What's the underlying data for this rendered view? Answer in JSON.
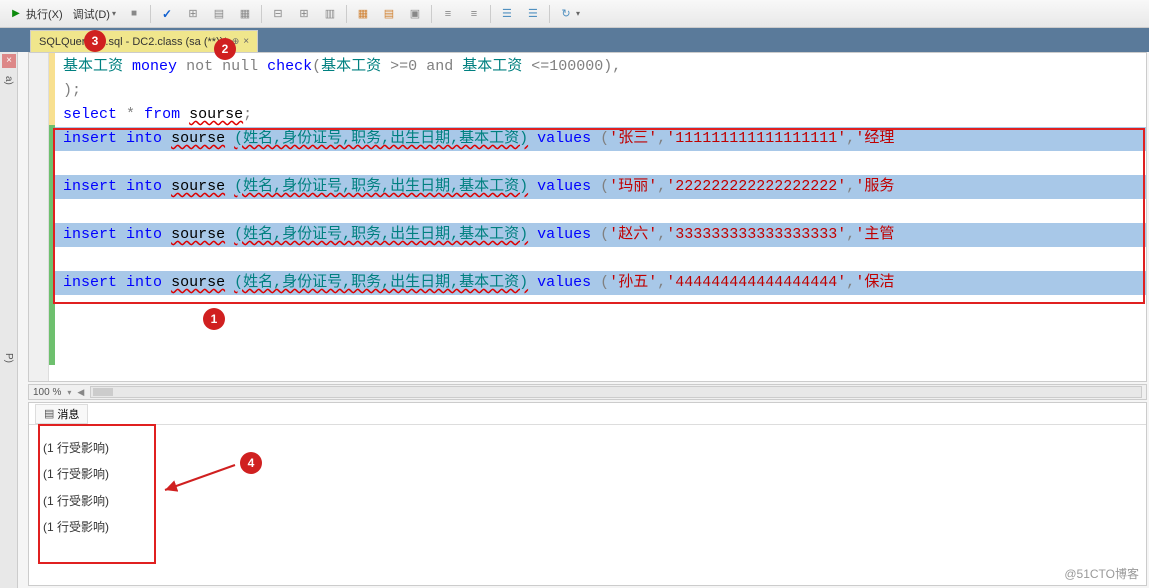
{
  "toolbar": {
    "execute_label": "执行(X)",
    "debug_label": "调试(D)"
  },
  "tab": {
    "title": "SQLQuery...0.sql - DC2.class (sa (**))*"
  },
  "left_panel": {
    "label_top": "a)",
    "label_mid": "P)"
  },
  "code": {
    "line1_col": "基本工资",
    "line1_type": "money",
    "line1_null": "not null",
    "line1_check": "check",
    "line1_cond": "(基本工资 >=0 and 基本工资 <=100000)",
    "line1_op_and": "and",
    "line1_val_min": ">=0",
    "line1_val_max": "<=100000",
    "line1_comma": ",",
    "line2": ");",
    "select_kw": "select",
    "select_star": "*",
    "select_from": "from",
    "select_table": "sourse",
    "select_semi": ";",
    "insert_kw": "insert",
    "into_kw": "into",
    "table": "sourse",
    "cols": "(姓名,身份证号,职务,出生日期,基本工资)",
    "values_kw": "values",
    "rows": [
      {
        "name": "张三",
        "id": "111111111111111111",
        "job": "经理"
      },
      {
        "name": "玛丽",
        "id": "222222222222222222",
        "job": "服务"
      },
      {
        "name": "赵六",
        "id": "333333333333333333",
        "job": "主管"
      },
      {
        "name": "孙五",
        "id": "444444444444444444",
        "job": "保洁"
      }
    ]
  },
  "zoom": {
    "level": "100 %"
  },
  "results": {
    "tab_label": "消息",
    "messages": [
      "(1 行受影响)",
      "(1 行受影响)",
      "(1 行受影响)",
      "(1 行受影响)"
    ]
  },
  "annotations": {
    "n1": "1",
    "n2": "2",
    "n3": "3",
    "n4": "4"
  },
  "watermark": "@51CTO博客"
}
